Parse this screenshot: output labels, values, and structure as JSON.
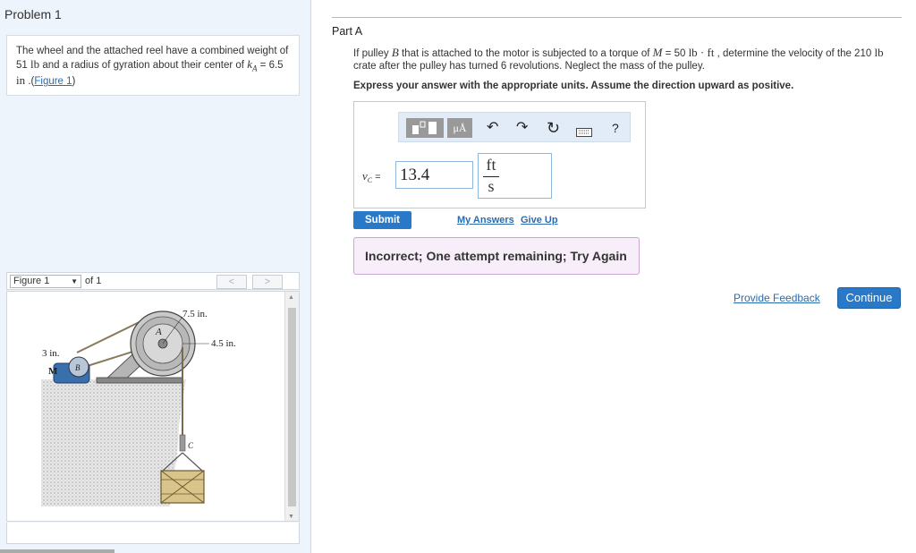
{
  "problem": {
    "title": "Problem 1",
    "text_1": "The wheel and the attached reel have a combined weight of",
    "text_2a": "51",
    "text_2unit": "lb",
    "text_2b": " and a radius of gyration about their center of ",
    "k_symbol": "k",
    "k_sub": "A",
    "text_2c": " = 6.5",
    "text_3unit": "in",
    "text_3b": " .(",
    "figure_link": "Figure 1",
    "text_3c": ")"
  },
  "figure_nav": {
    "selected": "Figure 1",
    "of_text": "of 1",
    "prev": "<",
    "next": ">"
  },
  "figure_labels": {
    "dim_top": "7.5 in.",
    "dim_right": "4.5 in.",
    "dim_left": "3 in.",
    "motor": "M",
    "point_a": "A",
    "point_b": "B",
    "point_c": "C"
  },
  "part": {
    "title": "Part A",
    "q_1": "If pulley ",
    "q_B": "B",
    "q_2": " that is attached to the motor is subjected to a torque of ",
    "q_M": "M",
    "q_3": " = 50 ",
    "q_unit1": "lb · ft",
    "q_4": " , determine the velocity of the 210 ",
    "q_unit2": "lb",
    "q_5": "crate after the pulley has turned 6 revolutions. Neglect the mass of the pulley.",
    "instruction": "Express your answer with the appropriate units. Assume the direction upward as positive."
  },
  "toolbar": {
    "units_label": "μÅ",
    "undo": "↶",
    "redo": "↷",
    "reset": "↻",
    "help": "?"
  },
  "answer": {
    "label": "v",
    "label_sub": "C",
    "equals": " =",
    "value": "13.4",
    "unit_num": "ft",
    "unit_den": "s"
  },
  "actions": {
    "submit": "Submit",
    "my_answers": "My Answers",
    "give_up": "Give Up",
    "feedback": "Incorrect; One attempt remaining; Try Again",
    "provide_feedback": "Provide Feedback",
    "continue": "Continue"
  }
}
